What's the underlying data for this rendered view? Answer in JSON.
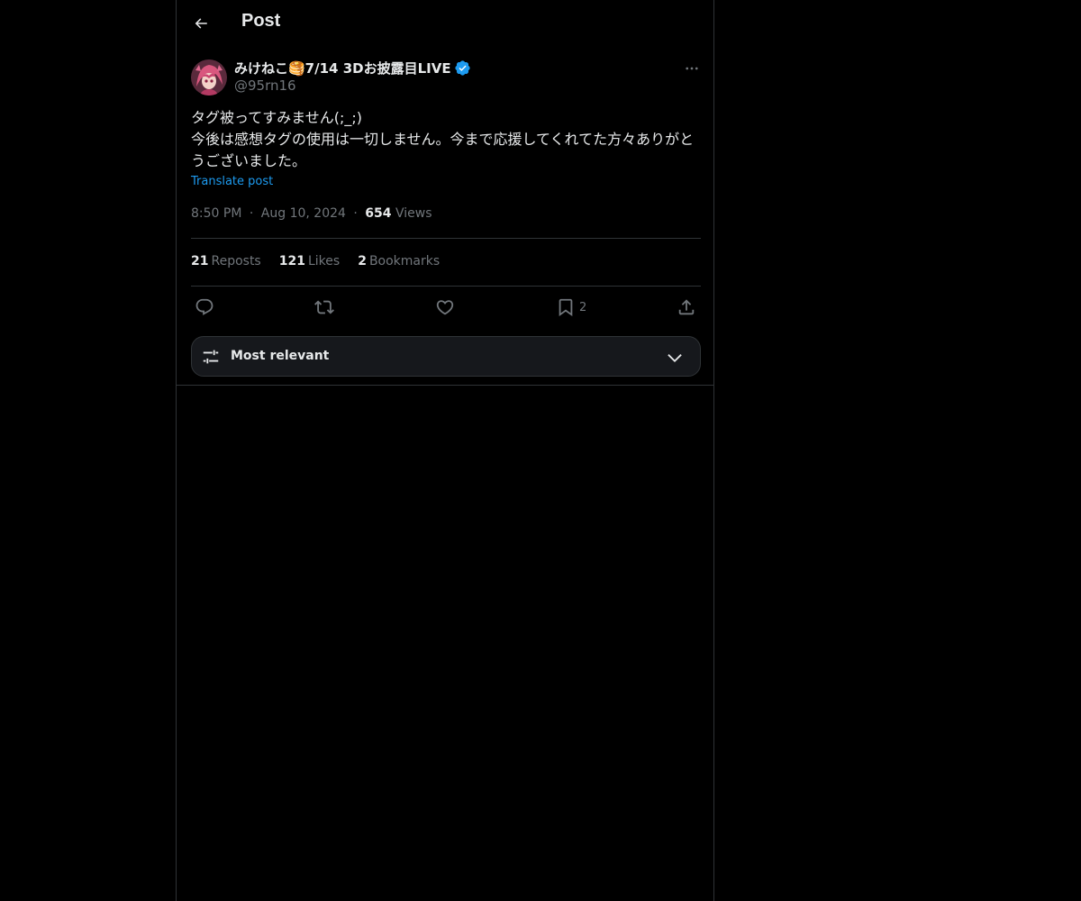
{
  "header": {
    "back_icon": "arrow-left-icon",
    "title": "Post"
  },
  "post": {
    "author": {
      "display_name": "みけねこ🥞7/14 3Dお披露目LIVE",
      "handle": "@95rn16",
      "verified": true,
      "verified_color": "#1d9bf0"
    },
    "text": "タグ被ってすみません(;_;)\n今後は感想タグの使用は一切しません。今まで応援してくれてた方々ありがとうございました。",
    "translate_label": "Translate post",
    "time": "8:50 PM",
    "date": "Aug 10, 2024",
    "separator": "·",
    "views_count": "654",
    "views_label": "Views",
    "stats": {
      "reposts_count": "21",
      "reposts_label": "Reposts",
      "likes_count": "121",
      "likes_label": "Likes",
      "bookmarks_count": "2",
      "bookmarks_label": "Bookmarks"
    },
    "actions": {
      "reply_icon": "reply-icon",
      "repost_icon": "repost-icon",
      "like_icon": "heart-icon",
      "bookmark_icon": "bookmark-icon",
      "bookmark_count": "2",
      "share_icon": "share-icon"
    }
  },
  "replies_sort": {
    "icon": "sliders-icon",
    "label": "Most relevant",
    "chevron": "chevron-down-icon"
  },
  "colors": {
    "background": "#000000",
    "text": "#e7e9ea",
    "secondary_text": "#71767b",
    "link": "#1d9bf0",
    "border": "#2f3336"
  }
}
